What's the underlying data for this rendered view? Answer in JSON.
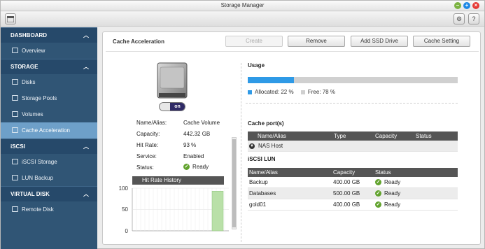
{
  "window": {
    "title": "Storage Manager"
  },
  "toolbar": {
    "settings_icon": "gear-icon",
    "help_label": "?"
  },
  "sidebar": {
    "sections": [
      {
        "label": "DASHBOARD",
        "items": [
          {
            "label": "Overview",
            "icon": "overview-icon"
          }
        ]
      },
      {
        "label": "STORAGE",
        "items": [
          {
            "label": "Disks",
            "icon": "disk-icon"
          },
          {
            "label": "Storage Pools",
            "icon": "storage-pool-icon"
          },
          {
            "label": "Volumes",
            "icon": "volume-icon"
          },
          {
            "label": "Cache Acceleration",
            "icon": "cache-icon",
            "active": true
          }
        ]
      },
      {
        "label": "iSCSI",
        "items": [
          {
            "label": "iSCSI Storage",
            "icon": "iscsi-icon"
          },
          {
            "label": "LUN Backup",
            "icon": "backup-icon"
          }
        ]
      },
      {
        "label": "VIRTUAL DISK",
        "items": [
          {
            "label": "Remote Disk",
            "icon": "remote-disk-icon"
          }
        ]
      }
    ]
  },
  "panel": {
    "title": "Cache Acceleration",
    "buttons": {
      "create": "Create",
      "remove": "Remove",
      "add_ssd": "Add SSD Drive",
      "cache_setting": "Cache Setting"
    },
    "toggle_label": "on",
    "properties": {
      "name_label": "Name/Alias:",
      "name_value": "Cache Volume",
      "capacity_label": "Capacity:",
      "capacity_value": "442.32 GB",
      "hitrate_label": "Hit Rate:",
      "hitrate_value": "93 %",
      "service_label": "Service:",
      "service_value": "Enabled",
      "status_label": "Status:",
      "status_value": "Ready"
    },
    "hit_rate_history": {
      "title": "Hit Rate History",
      "y_ticks": [
        "100",
        "50",
        "0"
      ],
      "current_value": 93
    },
    "usage": {
      "title": "Usage",
      "allocated_label": "Allocated: 22 %",
      "free_label": "Free: 78 %",
      "allocated_fraction": 0.22,
      "allocated_color": "#2f9ae6",
      "free_color": "#d0d0d0"
    },
    "cache_ports": {
      "title": "Cache port(s)",
      "columns": [
        "Name/Alias",
        "Type",
        "Capacity",
        "Status"
      ],
      "rows": [
        {
          "name": "NAS Host"
        }
      ]
    },
    "iscsi_lun": {
      "title": "iSCSI LUN",
      "columns": [
        "Name/Alias",
        "Capacity",
        "Status"
      ],
      "rows": [
        {
          "name": "Backup",
          "capacity": "400.00 GB",
          "status": "Ready"
        },
        {
          "name": "Databases",
          "capacity": "500.00 GB",
          "status": "Ready"
        },
        {
          "name": "gold01",
          "capacity": "400.00 GB",
          "status": "Ready"
        }
      ]
    }
  }
}
